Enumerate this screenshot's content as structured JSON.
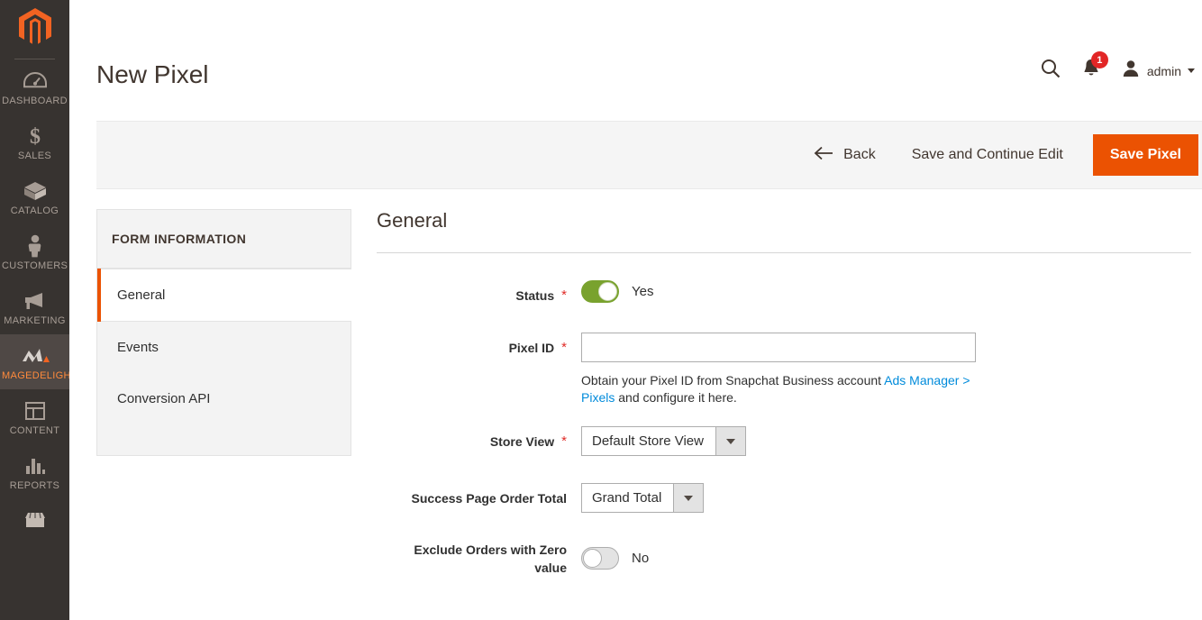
{
  "sidebar": {
    "logo": "magento-logo-icon",
    "items": [
      {
        "label": "DASHBOARD",
        "icon": "dashboard-icon",
        "active": false
      },
      {
        "label": "SALES",
        "icon": "dollar-sign-icon",
        "active": false
      },
      {
        "label": "CATALOG",
        "icon": "box-icon",
        "active": false
      },
      {
        "label": "CUSTOMERS",
        "icon": "person-icon",
        "active": false
      },
      {
        "label": "MARKETING",
        "icon": "megaphone-icon",
        "active": false
      },
      {
        "label": "MAGEDELIGHT",
        "icon": "magedelight-icon",
        "active": true
      },
      {
        "label": "CONTENT",
        "icon": "layout-icon",
        "active": false
      },
      {
        "label": "REPORTS",
        "icon": "bar-chart-icon",
        "active": false
      },
      {
        "label": "",
        "icon": "storefront-icon",
        "active": false
      }
    ]
  },
  "header": {
    "title": "New Pixel",
    "search_icon": "search-icon",
    "notifications_icon": "bell-icon",
    "notifications_count": "1",
    "user_icon": "user-avatar-icon",
    "user_name": "admin",
    "user_caret": "chevron-down-icon"
  },
  "action_bar": {
    "back_icon": "arrow-left-icon",
    "back_label": "Back",
    "save_continue_label": "Save and Continue Edit",
    "save_label": "Save Pixel",
    "primary_color": "#eb5202"
  },
  "form_nav": {
    "title": "FORM INFORMATION",
    "items": [
      {
        "label": "General",
        "active": true
      },
      {
        "label": "Events",
        "active": false
      },
      {
        "label": "Conversion API",
        "active": false
      }
    ]
  },
  "general_section": {
    "title": "General",
    "fields": {
      "status": {
        "label": "Status",
        "required": "*",
        "toggle_state": "Yes",
        "toggle_on": true
      },
      "pixel_id": {
        "label": "Pixel ID",
        "required": "*",
        "value": "",
        "placeholder": "",
        "note_prefix": "Obtain your Pixel ID from Snapchat Business account ",
        "note_link": "Ads Manager > Pixels",
        "note_suffix": " and configure it here."
      },
      "store_view": {
        "label": "Store View",
        "required": "*",
        "selected": "Default Store View"
      },
      "success_page_order_total": {
        "label": "Success Page Order Total",
        "required": "",
        "selected": "Grand Total"
      },
      "exclude_zero": {
        "label": "Exclude Orders with Zero value",
        "required": "",
        "toggle_state": "No",
        "toggle_on": false
      }
    }
  }
}
